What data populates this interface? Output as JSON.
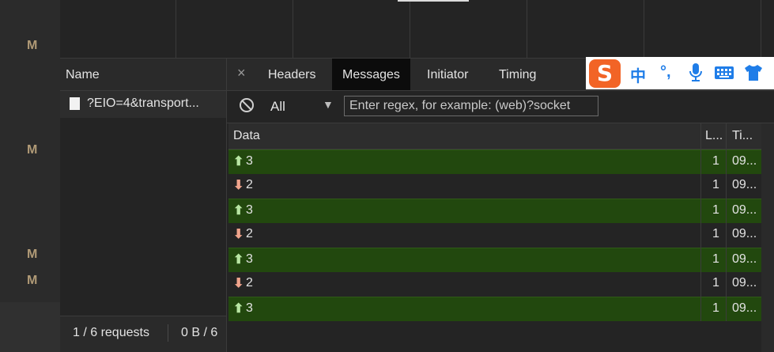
{
  "gutter": {
    "labels": [
      "M",
      "M",
      "M",
      "M"
    ]
  },
  "request_list": {
    "header": "Name",
    "items": [
      {
        "name": "?EIO=4&transport..."
      }
    ],
    "footer": {
      "requests": "1 / 6 requests",
      "transferred": "0 B / 6"
    }
  },
  "tabs": {
    "close": "×",
    "items": [
      "Headers",
      "Messages",
      "Initiator",
      "Timing"
    ],
    "active": "Messages"
  },
  "ime": {
    "logo": "S",
    "items": [
      "中",
      "°,",
      "mic-icon",
      "keyboard-icon",
      "shirt-icon"
    ]
  },
  "filter": {
    "type": "All",
    "placeholder": "Enter regex, for example: (web)?socket"
  },
  "messages": {
    "columns": [
      "Data",
      "L...",
      "Ti..."
    ],
    "rows": [
      {
        "dir": "sent",
        "arrow": "⬆",
        "data": "3",
        "length": "1",
        "time": "09..."
      },
      {
        "dir": "recv",
        "arrow": "⬇",
        "data": "2",
        "length": "1",
        "time": "09..."
      },
      {
        "dir": "sent",
        "arrow": "⬆",
        "data": "3",
        "length": "1",
        "time": "09..."
      },
      {
        "dir": "recv",
        "arrow": "⬇",
        "data": "2",
        "length": "1",
        "time": "09..."
      },
      {
        "dir": "sent",
        "arrow": "⬆",
        "data": "3",
        "length": "1",
        "time": "09..."
      },
      {
        "dir": "recv",
        "arrow": "⬇",
        "data": "2",
        "length": "1",
        "time": "09..."
      },
      {
        "dir": "sent",
        "arrow": "⬆",
        "data": "3",
        "length": "1",
        "time": "09..."
      }
    ]
  },
  "colors": {
    "sent_row": "#22480e",
    "sent_arrow": "#b8e6a3",
    "recv_arrow": "#f0a48c",
    "ime_logo": "#f26426",
    "ime_icons": "#1f7de8"
  }
}
